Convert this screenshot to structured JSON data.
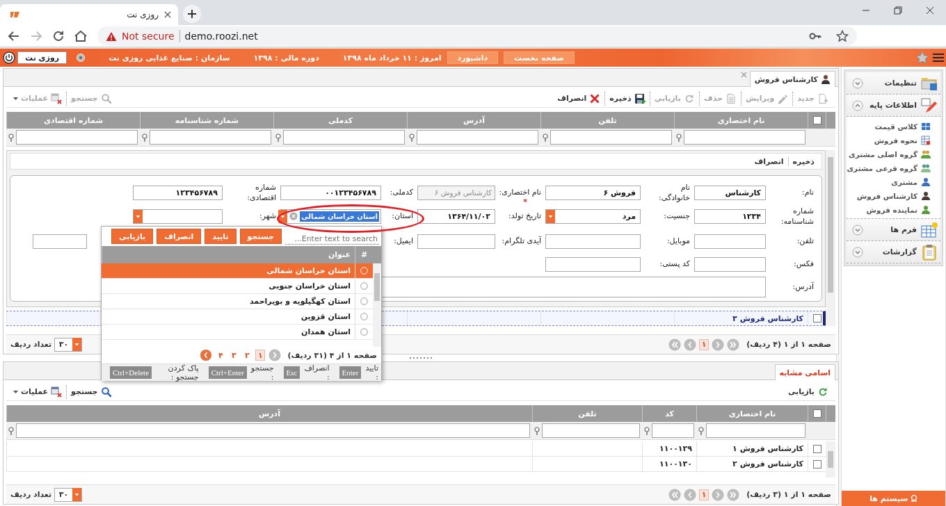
{
  "browser": {
    "tab_title": "روزی نت",
    "security": "Not secure",
    "url": "demo.roozi.net"
  },
  "header": {
    "buttons": [
      "صفحه نخست",
      "داشبورد"
    ],
    "info": [
      "امروز : ۱۱ خرداد ماه ۱۳۹۸",
      "دوره مالی : ۱۳۹۸",
      "سازمان : صنایع غذایی روزی نت"
    ],
    "user": "روزی نت"
  },
  "records": {
    "tab": {
      "label": "کارشناس فروش",
      "selected": true
    },
    "toolbar": {
      "items": [
        {
          "kind": "new",
          "label": "جدید",
          "disabled": true
        },
        {
          "kind": "edit",
          "label": "ویرایش",
          "disabled": true
        },
        {
          "kind": "delete",
          "label": "حذف",
          "disabled": true
        },
        {
          "kind": "restore",
          "label": "بازیابی",
          "disabled": true
        },
        {
          "kind": "save",
          "label": "ذخیره",
          "disabled": false
        },
        {
          "kind": "cancel",
          "label": "انصراف",
          "disabled": false
        }
      ],
      "side": [
        {
          "kind": "search",
          "label": "جستجو",
          "disabled": true
        },
        {
          "kind": "actions",
          "label": "عملیات",
          "disabled": true
        }
      ]
    },
    "grid": {
      "all_checked": false,
      "columns": [
        "نام اختصاری",
        "تلفن",
        "آدرس",
        "کدملی",
        "شماره شناسنامه",
        "شماره اقتصادی"
      ],
      "rows": [
        {
          "cells": [
            "کارشناس فروش ۳"
          ],
          "checked": false,
          "selected": true
        }
      ]
    },
    "form": {
      "actions": [
        "ذخیره",
        "انصراف"
      ],
      "rows": [
        [
          {
            "label": "نام:",
            "kind": "text",
            "value": "کارشناس"
          },
          {
            "label": "نام خانوادگی:",
            "kind": "text",
            "value": "فروش ۶"
          },
          {
            "label": "نام اختصاری:",
            "required_mark": "*",
            "kind": "locked",
            "value": "کارشناس فروش ۶"
          },
          {
            "label": "کدملی:",
            "kind": "text",
            "value": "۰۰۱۲۳۴۵۶۷۸۹"
          },
          {
            "label": "شماره اقتصادی:",
            "kind": "text",
            "value": "۱۲۳۴۵۶۷۸۹"
          }
        ],
        [
          {
            "label": "شماره شناسنامه:",
            "kind": "text",
            "value": "۱۲۳۴"
          },
          {
            "label": "جنسیت:",
            "kind": "select",
            "value": "مرد"
          },
          {
            "label": "تاریخ تولد:",
            "kind": "text",
            "value": "۱۳۶۴/۱۱/۰۲"
          },
          {
            "label": "استان:",
            "kind": "combo",
            "value": "استان خراسان شمالی",
            "expanded": true,
            "popup": {
              "search_placeholder": "Enter text to search...",
              "buttons": [
                "جستجو",
                "تایید",
                "انصراف",
                "بازیابی"
              ],
              "columns": [
                "#",
                "عنوان"
              ],
              "items": [
                {
                  "label": "استان خراسان شمالی",
                  "selected": true
                },
                {
                  "label": "استان خراسان جنوبی",
                  "selected": false
                },
                {
                  "label": "استان کهگیلویه و بویراحمد",
                  "selected": false
                },
                {
                  "label": "استان قزوین",
                  "selected": false
                },
                {
                  "label": "استان همدان",
                  "selected": false
                }
              ],
              "pager": {
                "text": "صفحه ۱ از ۴ (۳۱ ردیف)",
                "pages": [
                  {
                    "label": "۱",
                    "selected": true
                  },
                  {
                    "label": "۲",
                    "selected": false
                  },
                  {
                    "label": "۳",
                    "selected": false
                  },
                  {
                    "label": "۴",
                    "selected": false
                  }
                ]
              },
              "shortcuts": [
                {
                  "label": "تایید :",
                  "key": "Enter"
                },
                {
                  "label": "انصراف :",
                  "key": "Esc"
                },
                {
                  "label": "جستجو :",
                  "key": "Ctrl+Enter"
                },
                {
                  "label": "پاک کردن جستجو :",
                  "key": "Ctrl+Delete"
                }
              ]
            }
          },
          {
            "label": "شهر:",
            "kind": "select"
          }
        ],
        [
          {
            "label": "تلفن:",
            "kind": "text"
          },
          {
            "label": "موبایل:",
            "kind": "text"
          },
          {
            "label": "آیدی تلگرام:",
            "kind": "text"
          },
          {
            "label": "ایمیل:",
            "kind": "covered"
          },
          {
            "kind": "covered"
          },
          {
            "kind": "text"
          }
        ],
        [
          {
            "label": "فکس:",
            "kind": "text"
          },
          {
            "label": "کد پستی:",
            "kind": "text"
          }
        ],
        [
          {
            "label": "آدرس:",
            "kind": "textarea"
          }
        ]
      ]
    },
    "pager": {
      "text": "صفحه ۱ از ۱ (۴ ردیف)",
      "pages": [
        {
          "label": "۱",
          "selected": true
        }
      ],
      "page_size": "۳۰",
      "page_size_label": "تعداد ردیف"
    }
  },
  "similar": {
    "tab": {
      "label": "اسامی مشابه",
      "selected": true
    },
    "toolbar": {
      "items": [
        {
          "kind": "restore",
          "label": "بازیابی",
          "disabled": false
        }
      ],
      "side": [
        {
          "kind": "search",
          "label": "جستجو",
          "disabled": false
        },
        {
          "kind": "actions",
          "label": "عملیات",
          "disabled": false
        }
      ]
    },
    "grid": {
      "all_checked": false,
      "columns": [
        "نام اختصاری",
        "کد",
        "تلفن",
        "آدرس"
      ],
      "rows": [
        {
          "cells": [
            "کارشناس فروش ۱",
            "۱۱۰۰۱۲۹"
          ],
          "checked": false,
          "selected": false
        },
        {
          "cells": [
            "کارشناس فروش ۲",
            "۱۱۰۰۱۳۰"
          ],
          "checked": false,
          "selected": false
        }
      ]
    },
    "pager": {
      "text": "صفحه ۱ از ۱ (۳ ردیف)",
      "pages": [
        {
          "label": "۱",
          "selected": true
        }
      ],
      "page_size": "۳۰",
      "page_size_label": "تعداد ردیف"
    }
  },
  "sidebar": {
    "sections": [
      {
        "label": "تنظیمات",
        "expanded": false
      },
      {
        "label": "اطلاعات پایه",
        "expanded": true,
        "children": [
          {
            "label": "کلاس قیمت"
          },
          {
            "label": "نحوه فروش"
          },
          {
            "label": "گروه اصلی مشتری"
          },
          {
            "label": "گروه فرعی مشتری"
          },
          {
            "label": "مشتری"
          },
          {
            "label": "کارشناس فروش"
          },
          {
            "label": "نماینده فروش"
          }
        ]
      },
      {
        "label": "فرم ها",
        "expanded": false
      },
      {
        "label": "گزارشات",
        "expanded": false
      }
    ],
    "system_button": "سیستم ها"
  }
}
